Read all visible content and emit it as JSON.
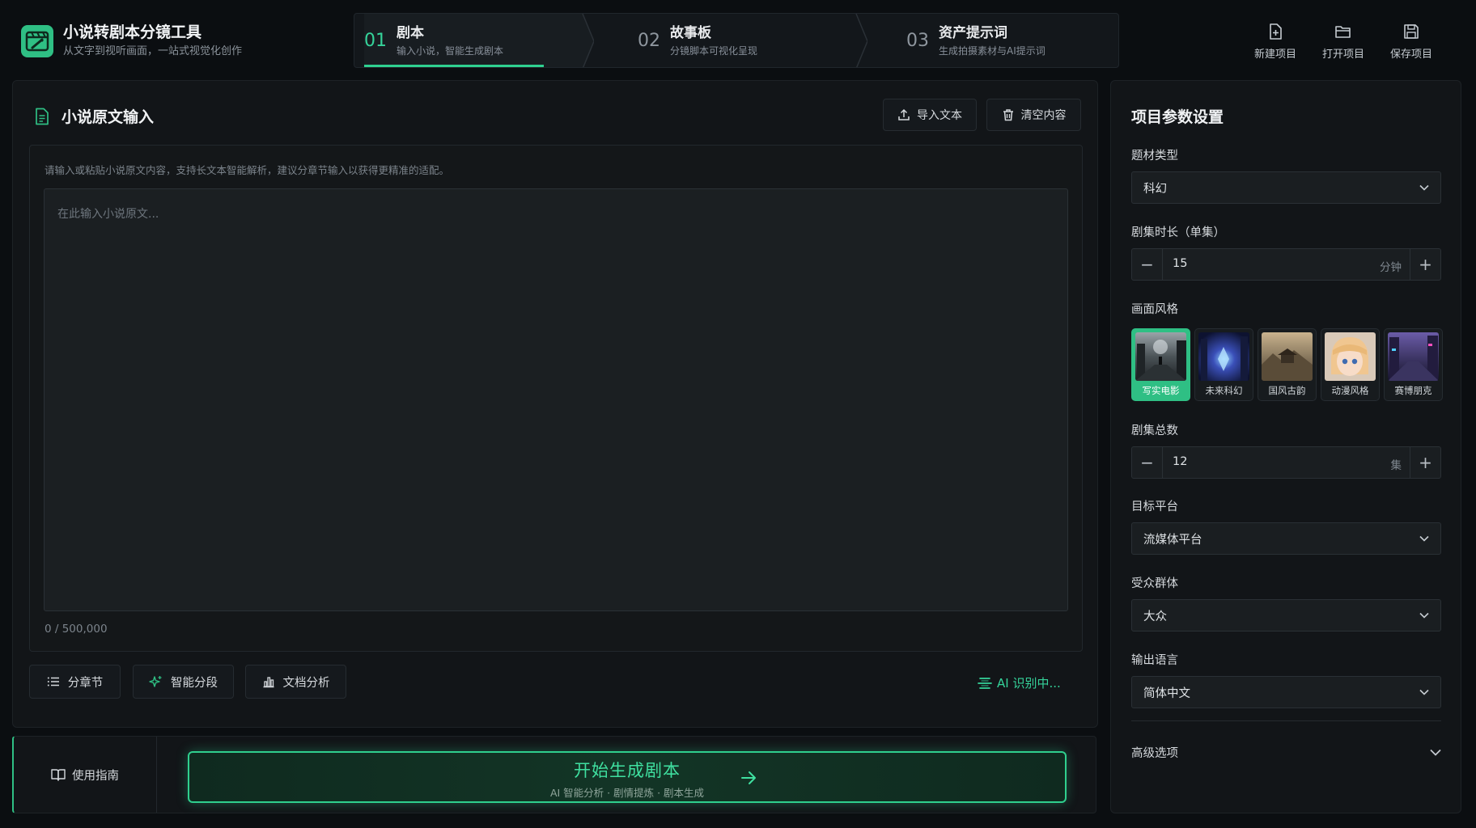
{
  "app": {
    "title": "小说转剧本分镜工具",
    "subtitle": "从文字到视听画面，一站式视觉化创作"
  },
  "steps": [
    {
      "num": "01",
      "title": "剧本",
      "subtitle": "输入小说，智能生成剧本",
      "active": true
    },
    {
      "num": "02",
      "title": "故事板",
      "subtitle": "分镜脚本可视化呈现",
      "active": false
    },
    {
      "num": "03",
      "title": "资产提示词",
      "subtitle": "生成拍摄素材与AI提示词",
      "active": false
    }
  ],
  "top_actions": [
    {
      "label": "新建项目",
      "icon": "file-plus-icon"
    },
    {
      "label": "打开项目",
      "icon": "folder-open-icon"
    },
    {
      "label": "保存项目",
      "icon": "save-icon"
    }
  ],
  "editor": {
    "title": "小说原文输入",
    "import_label": "导入文本",
    "clear_label": "清空内容",
    "hint": "请输入或粘贴小说原文内容，支持长文本智能解析，建议分章节输入以获得更精准的适配。",
    "placeholder": "在此输入小说原文...",
    "value": "",
    "counter": "0 / 500,000"
  },
  "tools": [
    {
      "label": "分章节",
      "icon": "list-icon"
    },
    {
      "label": "智能分段",
      "icon": "sparkle-icon"
    },
    {
      "label": "文档分析",
      "icon": "bar-chart-icon"
    }
  ],
  "ai_status": "AI 识别中...",
  "footer": {
    "guide_label": "使用指南",
    "cta_title": "开始生成剧本",
    "cta_subtitle": "AI 智能分析 · 剧情提炼 · 剧本生成"
  },
  "settings": {
    "title": "项目参数设置",
    "genre": {
      "label": "题材类型",
      "value": "科幻"
    },
    "duration": {
      "label": "剧集时长（单集）",
      "value": "15",
      "unit": "分钟"
    },
    "style": {
      "label": "画面风格",
      "options": [
        {
          "name": "写实电影",
          "active": true
        },
        {
          "name": "未来科幻",
          "active": false
        },
        {
          "name": "国风古韵",
          "active": false
        },
        {
          "name": "动漫风格",
          "active": false
        },
        {
          "name": "赛博朋克",
          "active": false
        }
      ]
    },
    "episodes": {
      "label": "剧集总数",
      "value": "12",
      "unit": "集"
    },
    "platform": {
      "label": "目标平台",
      "value": "流媒体平台"
    },
    "audience": {
      "label": "受众群体",
      "value": "大众"
    },
    "language": {
      "label": "输出语言",
      "value": "简体中文"
    },
    "advanced_label": "高级选项"
  },
  "colors": {
    "accent": "#2fbf84",
    "accent_bright": "#35d39a",
    "background": "#0b0e11",
    "panel": "#121518"
  }
}
